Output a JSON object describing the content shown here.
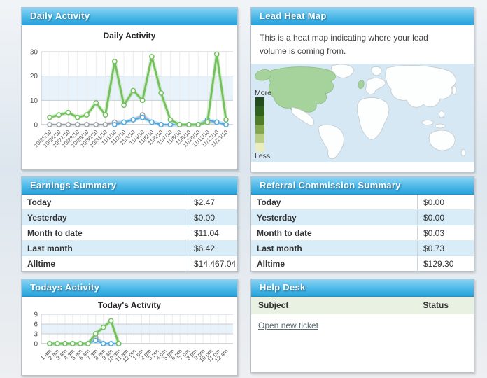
{
  "colors": {
    "header_gradient_top": "#8ad3f4",
    "header_gradient_bottom": "#28a3db",
    "green_line": "#72c15d",
    "blue_line": "#4fa8e0",
    "gray_line": "#999fa5",
    "shaded_band": "#e7f2fa",
    "table_alt_row": "#d9edf9",
    "ocean": "#d6e8f3",
    "active_region_green": "#a6d39c"
  },
  "panels": {
    "daily_activity": {
      "title": "Daily Activity"
    },
    "lead_heat_map": {
      "title": "Lead Heat Map",
      "description": "This is a heat map indicating where your lead volume is coming from.",
      "legend_more": "More",
      "legend_less": "Less",
      "legend_colors": [
        "#234d1e",
        "#2f611f",
        "#4f7d2a",
        "#85a84f",
        "#b9cd84",
        "#e9edc0"
      ],
      "highlighted_regions": [
        "North America",
        "United Kingdom"
      ]
    },
    "earnings_summary": {
      "title": "Earnings Summary",
      "rows": [
        {
          "label": "Today",
          "value": "$2.47"
        },
        {
          "label": "Yesterday",
          "value": "$0.00"
        },
        {
          "label": "Month to date",
          "value": "$11.04"
        },
        {
          "label": "Last month",
          "value": "$6.42"
        },
        {
          "label": "Alltime",
          "value": "$14,467.04"
        }
      ]
    },
    "referral_summary": {
      "title": "Referral Commission Summary",
      "rows": [
        {
          "label": "Today",
          "value": "$0.00"
        },
        {
          "label": "Yesterday",
          "value": "$0.00"
        },
        {
          "label": "Month to date",
          "value": "$0.03"
        },
        {
          "label": "Last month",
          "value": "$0.73"
        },
        {
          "label": "Alltime",
          "value": "$129.30"
        }
      ]
    },
    "todays_activity": {
      "title": "Todays Activity"
    },
    "help_desk": {
      "title": "Help Desk",
      "subject_header": "Subject",
      "status_header": "Status",
      "open_ticket_link": "Open new ticket"
    }
  },
  "chart_data": [
    {
      "type": "line",
      "title": "Daily Activity",
      "categories": [
        "10/25/10",
        "10/26/10",
        "10/27/10",
        "10/28/10",
        "10/29/10",
        "10/30/10",
        "10/31/10",
        "11/1/10",
        "11/2/10",
        "11/3/10",
        "11/4/10",
        "11/5/10",
        "11/6/10",
        "11/7/10",
        "11/8/10",
        "11/9/10",
        "11/10/10",
        "11/11/10",
        "11/12/10",
        "11/13/10"
      ],
      "series": [
        {
          "name": "gray",
          "color": "#999fa5",
          "glow": "#cdd1d4",
          "values": [
            0,
            0,
            0,
            0,
            0,
            0,
            0,
            1,
            1,
            2,
            4,
            1,
            0,
            0,
            0,
            0,
            0,
            1,
            1,
            0
          ]
        },
        {
          "name": "blue",
          "color": "#4fa8e0",
          "glow": "#aed7f2",
          "values": [
            null,
            null,
            null,
            null,
            null,
            null,
            null,
            0,
            1,
            2,
            3,
            1,
            0,
            0,
            0,
            0,
            0,
            2,
            1,
            0
          ]
        },
        {
          "name": "green",
          "color": "#72c15d",
          "glow": "#bce2ad",
          "values": [
            3,
            4,
            5,
            3,
            4,
            9,
            4,
            26,
            8,
            14,
            10,
            28,
            13,
            2,
            0,
            0,
            0,
            1,
            29,
            2
          ]
        }
      ],
      "ylim": [
        0,
        30
      ],
      "yticks": [
        0,
        10,
        20,
        30
      ],
      "shaded_band": [
        10,
        20
      ],
      "grid": true,
      "legend": "none"
    },
    {
      "type": "line",
      "title": "Today's Activity",
      "categories": [
        "1 am",
        "2 am",
        "3 am",
        "4 am",
        "5 am",
        "6 am",
        "7 am",
        "8 am",
        "9 am",
        "10 am",
        "11 am",
        "12 pm",
        "1 pm",
        "2 pm",
        "3 pm",
        "4 pm",
        "5 pm",
        "6 pm",
        "7 pm",
        "8 pm",
        "9 pm",
        "10 pm",
        "11 pm",
        "12 am"
      ],
      "series": [
        {
          "name": "gray",
          "color": "#999fa5",
          "glow": "#cdd1d4",
          "values": [
            0,
            0,
            0,
            0,
            0,
            0,
            2,
            0,
            0,
            0
          ]
        },
        {
          "name": "blue",
          "color": "#4fa8e0",
          "glow": "#aed7f2",
          "values": [
            0,
            0,
            0,
            0,
            0,
            0,
            1,
            0,
            0,
            0
          ]
        },
        {
          "name": "green",
          "color": "#72c15d",
          "glow": "#bce2ad",
          "values": [
            0,
            0,
            0,
            0,
            0,
            0,
            3,
            5,
            7,
            0
          ]
        }
      ],
      "ylim": [
        0,
        9
      ],
      "yticks": [
        0,
        3,
        6,
        9
      ],
      "shaded_band": [
        3,
        6
      ],
      "grid": true,
      "legend": "none"
    }
  ]
}
